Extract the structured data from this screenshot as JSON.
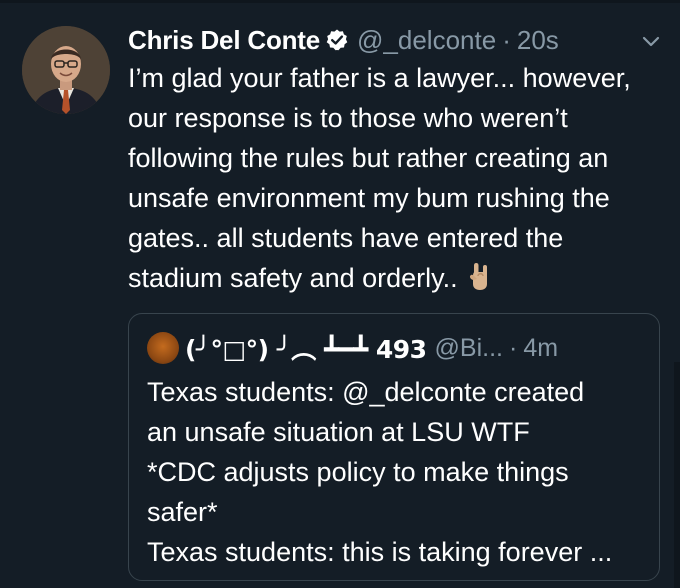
{
  "tweet": {
    "author_name": "Chris Del Conte",
    "handle": "@_delconte",
    "separator": "·",
    "time": "20s",
    "text_lines": [
      "I’m glad your father is a lawyer... however,",
      "our response is to those who weren’t",
      "following the rules but rather creating an",
      "unsafe environment my bum rushing the",
      "gates.. all students have entered the",
      "stadium safety and orderly.."
    ],
    "emoji": "horns-hand-emoji"
  },
  "quoted_tweet": {
    "author_name": "(╯°□°) ╯︵ ┻━┻ 493",
    "handle": "@Bi...",
    "separator": "·",
    "time": "4m",
    "text_lines": [
      "Texas students: @_delconte created",
      "an unsafe situation at LSU WTF",
      "*CDC adjusts policy to make things",
      "safer*",
      "Texas students: this is taking forever ..."
    ]
  },
  "colors": {
    "background": "#141d26",
    "secondary_text": "#8899a6",
    "border": "#38444d",
    "verified_badge": "#ffffff"
  },
  "icons": {
    "verified": "verified-badge-icon",
    "menu": "chevron-down-icon"
  }
}
